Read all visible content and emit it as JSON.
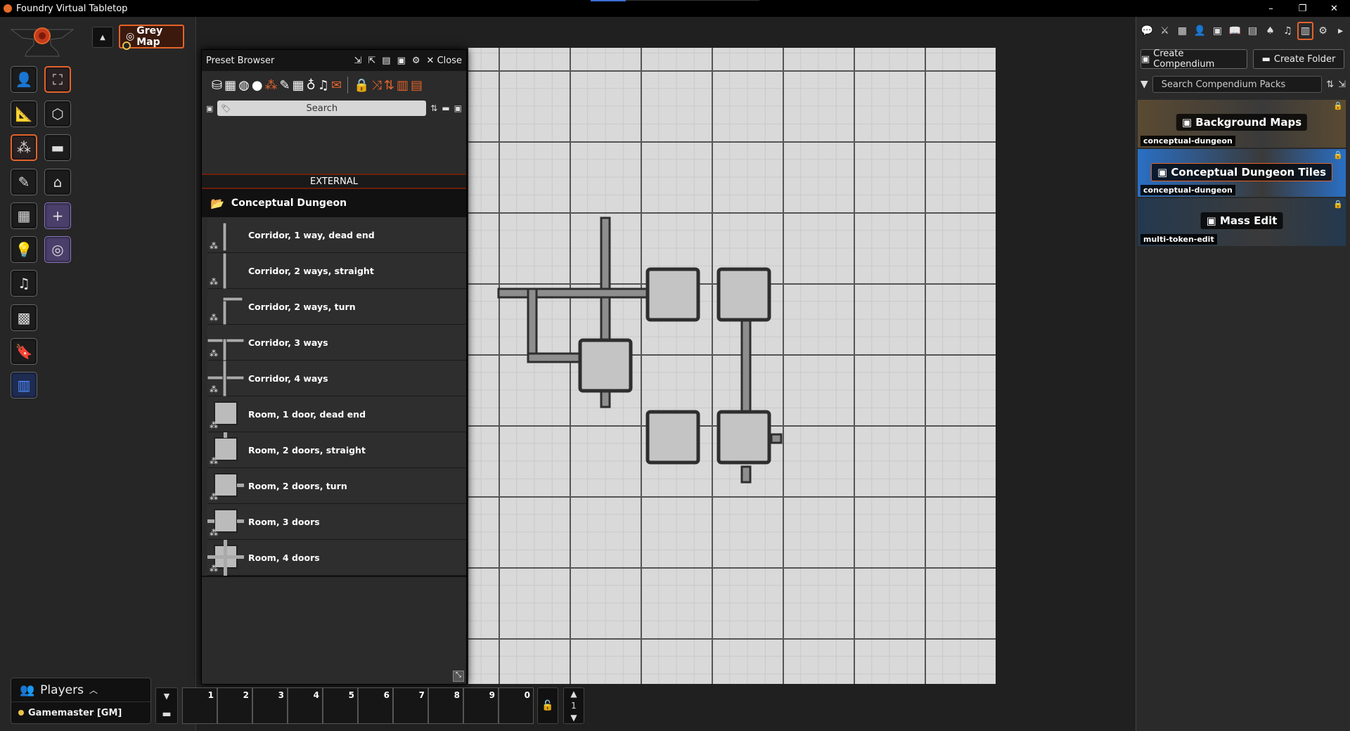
{
  "window": {
    "title": "Foundry Virtual Tabletop",
    "controls": [
      "–",
      "❐",
      "✕"
    ]
  },
  "scene_nav": {
    "collapse_icon": "caret-up-icon",
    "active_scene": "Grey Map"
  },
  "controls": {
    "left_column": [
      "token-icon",
      "ruler-icon",
      "tiles-icon",
      "drawing-icon",
      "walls-icon",
      "lighting-icon",
      "sound-icon",
      "regions-icon",
      "notes-icon",
      "compendium-browser-icon"
    ],
    "right_column": [
      "select-icon",
      "cube-icon",
      "folder-icon",
      "home-icon",
      "plus-icon",
      "spiral-icon"
    ]
  },
  "preset_browser": {
    "title": "Preset Browser",
    "close_label": "Close",
    "search_placeholder": "Search",
    "section_label": "EXTERNAL",
    "folder_name": "Conceptual Dungeon",
    "items": [
      {
        "label": "Corridor, 1 way, dead end",
        "kind": "corridor1"
      },
      {
        "label": "Corridor, 2 ways, straight",
        "kind": "corridor2s"
      },
      {
        "label": "Corridor, 2 ways, turn",
        "kind": "corridor2t"
      },
      {
        "label": "Corridor, 3 ways",
        "kind": "corridor3"
      },
      {
        "label": "Corridor, 4 ways",
        "kind": "corridor4"
      },
      {
        "label": "Room, 1 door, dead end",
        "kind": "room1"
      },
      {
        "label": "Room, 2 doors, straight",
        "kind": "room2s"
      },
      {
        "label": "Room, 2 doors, turn",
        "kind": "room2t"
      },
      {
        "label": "Room, 3 doors",
        "kind": "room3"
      },
      {
        "label": "Room, 4 doors",
        "kind": "room4"
      }
    ]
  },
  "sidebar": {
    "tab_icons": [
      "chat-icon",
      "combat-icon",
      "scenes-icon",
      "actors-icon",
      "items-icon",
      "journal-icon",
      "tables-icon",
      "cards-icon",
      "playlists-icon",
      "compendium-icon",
      "settings-icon",
      "collapse-icon"
    ],
    "create_compendium": "Create Compendium",
    "create_folder": "Create Folder",
    "search_placeholder": "Search Compendium Packs",
    "packs": [
      {
        "name": "Background Maps",
        "module": "conceptual-dungeon",
        "bg": "#5a4a32"
      },
      {
        "name": "Conceptual Dungeon Tiles",
        "module": "conceptual-dungeon",
        "bg": "#2a6fc4"
      },
      {
        "name": "Mass Edit",
        "module": "multi-token-edit",
        "bg": "#24394f"
      }
    ]
  },
  "players": {
    "title": "Players",
    "users": [
      {
        "name": "Gamemaster [GM]",
        "color": "#e8c24a"
      }
    ]
  },
  "hotbar": {
    "slots": [
      "1",
      "2",
      "3",
      "4",
      "5",
      "6",
      "7",
      "8",
      "9",
      "0"
    ],
    "page": "1"
  },
  "colors": {
    "accent": "#e4632a"
  }
}
